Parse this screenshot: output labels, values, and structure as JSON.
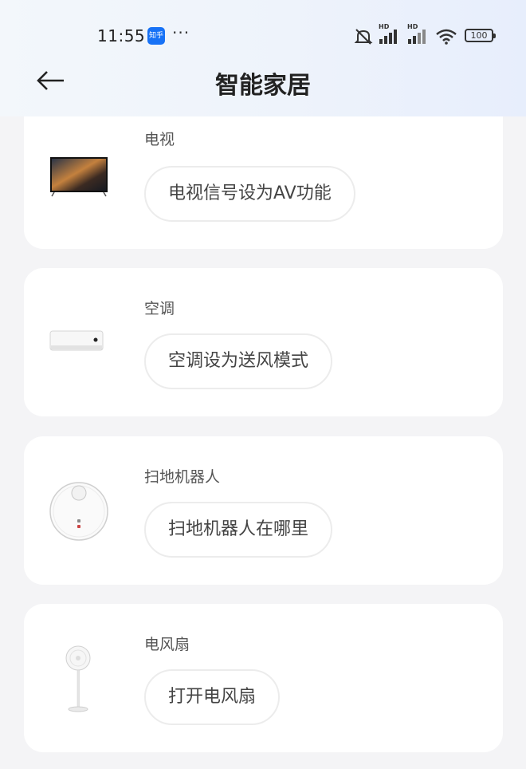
{
  "status_bar": {
    "time": "11:55",
    "app_badge": "知乎",
    "more": "···",
    "signal_1_label": "HD",
    "signal_2_label": "HD",
    "battery": "100"
  },
  "header": {
    "title": "智能家居"
  },
  "devices": [
    {
      "name": "电视",
      "command": "电视信号设为AV功能",
      "icon": "tv-icon"
    },
    {
      "name": "空调",
      "command": "空调设为送风模式",
      "icon": "air-conditioner-icon"
    },
    {
      "name": "扫地机器人",
      "command": "扫地机器人在哪里",
      "icon": "robot-vacuum-icon"
    },
    {
      "name": "电风扇",
      "command": "打开电风扇",
      "icon": "fan-icon"
    }
  ],
  "colors": {
    "accent_blue": "#1772f6",
    "card_bg": "#ffffff",
    "page_bg": "#f4f4f6"
  }
}
